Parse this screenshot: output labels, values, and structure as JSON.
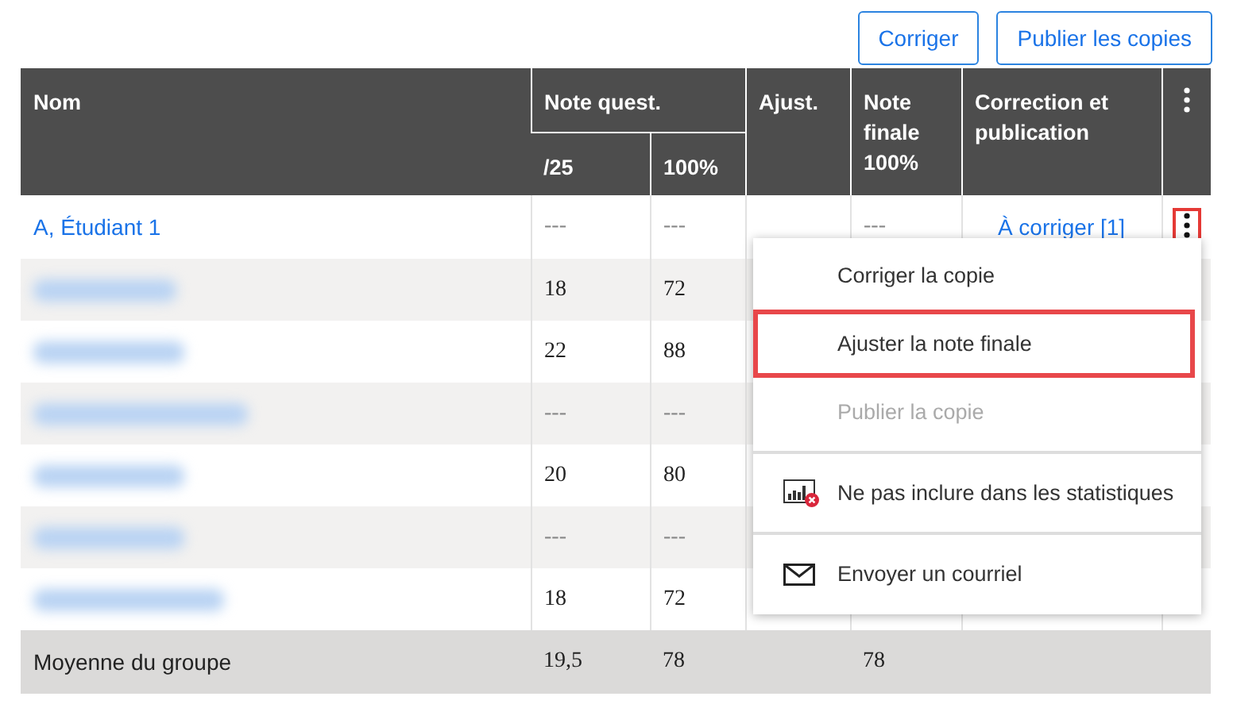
{
  "toolbar": {
    "buttons": [
      "Corriger",
      "Publier les copies"
    ]
  },
  "table": {
    "columns": {
      "name": "Nom",
      "questions": "Note quest.",
      "q_points": "/25",
      "q_percent": "100%",
      "adjust": "Ajust.",
      "final": "Note finale 100%",
      "correction": "Correction et publication"
    },
    "rows": [
      {
        "kind": "named",
        "name": "A, Étudiant 1",
        "points": "---",
        "percent": "---",
        "adjust": "",
        "final": "---",
        "correction": "À corriger [1]",
        "menu_button": {
          "focused": true
        }
      },
      {
        "kind": "blurred",
        "points": "18",
        "percent": "72"
      },
      {
        "kind": "blurred",
        "points": "22",
        "percent": "88"
      },
      {
        "kind": "blurred",
        "points": "---",
        "percent": "---"
      },
      {
        "kind": "blurred",
        "points": "20",
        "percent": "80"
      },
      {
        "kind": "blurred",
        "points": "---",
        "percent": "---"
      },
      {
        "kind": "blurred",
        "points": "18",
        "percent": "72"
      }
    ],
    "footer": {
      "label": "Moyenne du groupe",
      "points": "19,5",
      "percent": "78",
      "final": "78"
    }
  },
  "context_menu": {
    "items": [
      {
        "label": "Corriger la copie",
        "kind": "plain",
        "disabled": false,
        "selected": false,
        "divider_before": false
      },
      {
        "label": "Ajuster la note finale",
        "kind": "plain",
        "disabled": false,
        "selected": true,
        "divider_before": false
      },
      {
        "label": "Publier la copie",
        "kind": "plain",
        "disabled": true,
        "selected": false,
        "divider_before": false
      },
      {
        "label": "Ne pas inclure dans les statistiques",
        "kind": "stats",
        "disabled": false,
        "selected": false,
        "divider_before": true
      },
      {
        "label": "Envoyer un courriel",
        "kind": "email",
        "disabled": false,
        "selected": false,
        "divider_before": true
      }
    ]
  }
}
